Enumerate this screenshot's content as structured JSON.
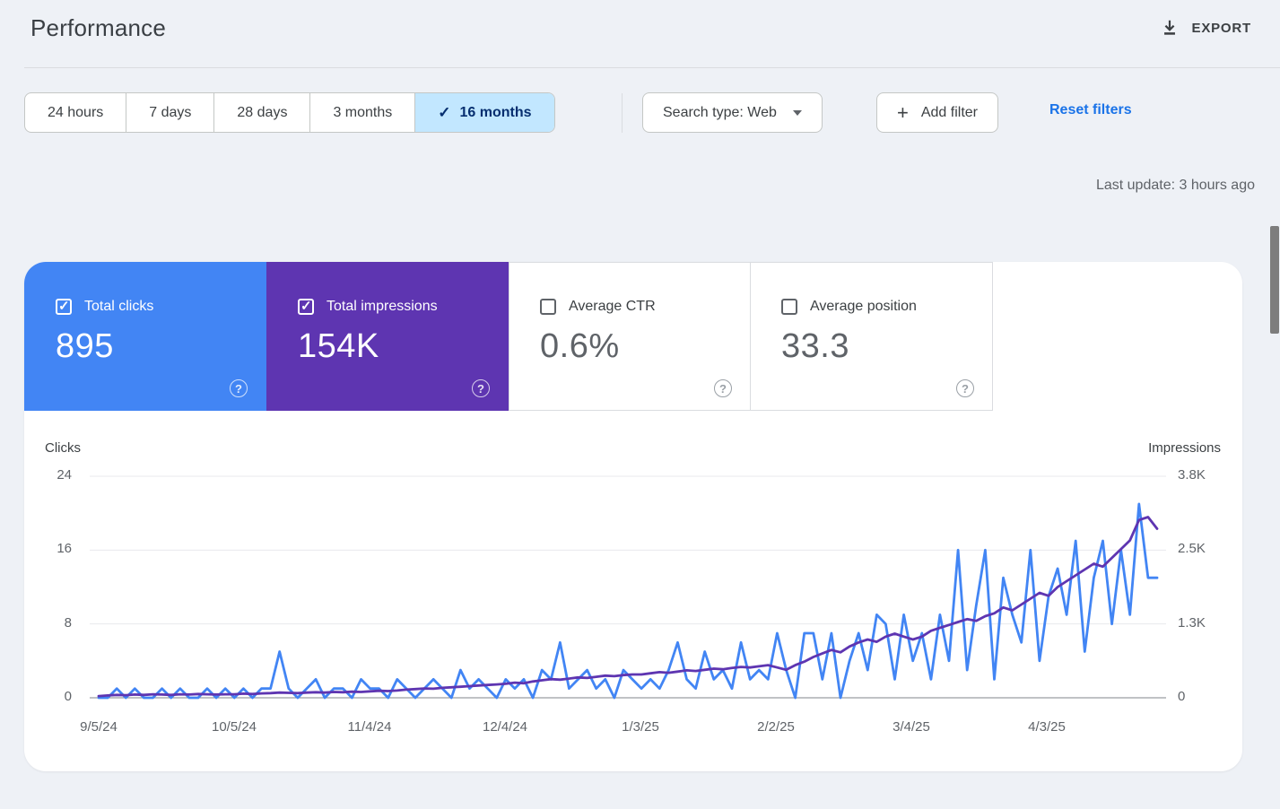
{
  "header": {
    "title": "Performance",
    "export_label": "EXPORT"
  },
  "filters": {
    "date_ranges": [
      {
        "label": "24 hours",
        "selected": false
      },
      {
        "label": "7 days",
        "selected": false
      },
      {
        "label": "28 days",
        "selected": false
      },
      {
        "label": "3 months",
        "selected": false
      },
      {
        "label": "16 months",
        "selected": true
      }
    ],
    "search_type_label": "Search type: Web",
    "add_filter_label": "Add filter",
    "reset_label": "Reset filters"
  },
  "last_update": "Last update: 3 hours ago",
  "metrics": [
    {
      "label": "Total clicks",
      "value": "895",
      "checked": true,
      "color": "#4285f4"
    },
    {
      "label": "Total impressions",
      "value": "154K",
      "checked": true,
      "color": "#5e35b1"
    },
    {
      "label": "Average CTR",
      "value": "0.6%",
      "checked": false,
      "color": ""
    },
    {
      "label": "Average position",
      "value": "33.3",
      "checked": false,
      "color": ""
    }
  ],
  "chart_data": {
    "type": "line",
    "left_axis": {
      "label": "Clicks",
      "max": 24,
      "tick_values": [
        0,
        8,
        16,
        24
      ],
      "tick_labels_top_down": [
        "24",
        "16",
        "8",
        "0"
      ]
    },
    "right_axis": {
      "label": "Impressions",
      "max": 3800,
      "tick_values": [
        0,
        1267,
        2533,
        3800
      ],
      "tick_labels_top_down": [
        "3.8K",
        "2.5K",
        "1.3K",
        "0"
      ]
    },
    "x_tick_labels": [
      "9/5/24",
      "10/5/24",
      "11/4/24",
      "12/4/24",
      "1/3/25",
      "2/2/25",
      "3/4/25",
      "4/3/25"
    ],
    "grid": true,
    "series": [
      {
        "name": "Clicks",
        "axis": "left",
        "color": "#4285f4",
        "values": [
          0,
          0,
          1,
          0,
          1,
          0,
          0,
          1,
          0,
          1,
          0,
          0,
          1,
          0,
          1,
          0,
          1,
          0,
          1,
          1,
          5,
          1,
          0,
          1,
          2,
          0,
          1,
          1,
          0,
          2,
          1,
          1,
          0,
          2,
          1,
          0,
          1,
          2,
          1,
          0,
          3,
          1,
          2,
          1,
          0,
          2,
          1,
          2,
          0,
          3,
          2,
          6,
          1,
          2,
          3,
          1,
          2,
          0,
          3,
          2,
          1,
          2,
          1,
          3,
          6,
          2,
          1,
          5,
          2,
          3,
          1,
          6,
          2,
          3,
          2,
          7,
          3,
          0,
          7,
          7,
          2,
          7,
          0,
          4,
          7,
          3,
          9,
          8,
          2,
          9,
          4,
          7,
          2,
          9,
          4,
          16,
          3,
          10,
          16,
          2,
          13,
          9,
          6,
          16,
          4,
          11,
          14,
          9,
          17,
          5,
          13,
          17,
          8,
          16,
          9,
          21,
          13,
          13
        ]
      },
      {
        "name": "Impressions",
        "axis": "right",
        "color": "#5e35b1",
        "values": [
          30,
          40,
          50,
          45,
          55,
          50,
          60,
          55,
          50,
          60,
          55,
          65,
          60,
          55,
          60,
          60,
          70,
          65,
          75,
          80,
          90,
          85,
          80,
          90,
          95,
          90,
          100,
          95,
          105,
          100,
          110,
          120,
          115,
          125,
          140,
          150,
          160,
          155,
          170,
          180,
          190,
          200,
          210,
          220,
          230,
          240,
          260,
          250,
          280,
          300,
          320,
          310,
          330,
          350,
          340,
          360,
          380,
          370,
          390,
          400,
          400,
          420,
          440,
          430,
          450,
          470,
          460,
          480,
          500,
          490,
          510,
          530,
          520,
          540,
          560,
          520,
          480,
          560,
          620,
          700,
          760,
          820,
          780,
          880,
          950,
          1000,
          960,
          1050,
          1100,
          1050,
          1000,
          1050,
          1150,
          1200,
          1250,
          1300,
          1350,
          1320,
          1400,
          1450,
          1550,
          1500,
          1600,
          1700,
          1800,
          1750,
          1900,
          2000,
          2100,
          2200,
          2300,
          2250,
          2400,
          2550,
          2700,
          3050,
          3100,
          2900
        ]
      }
    ]
  }
}
